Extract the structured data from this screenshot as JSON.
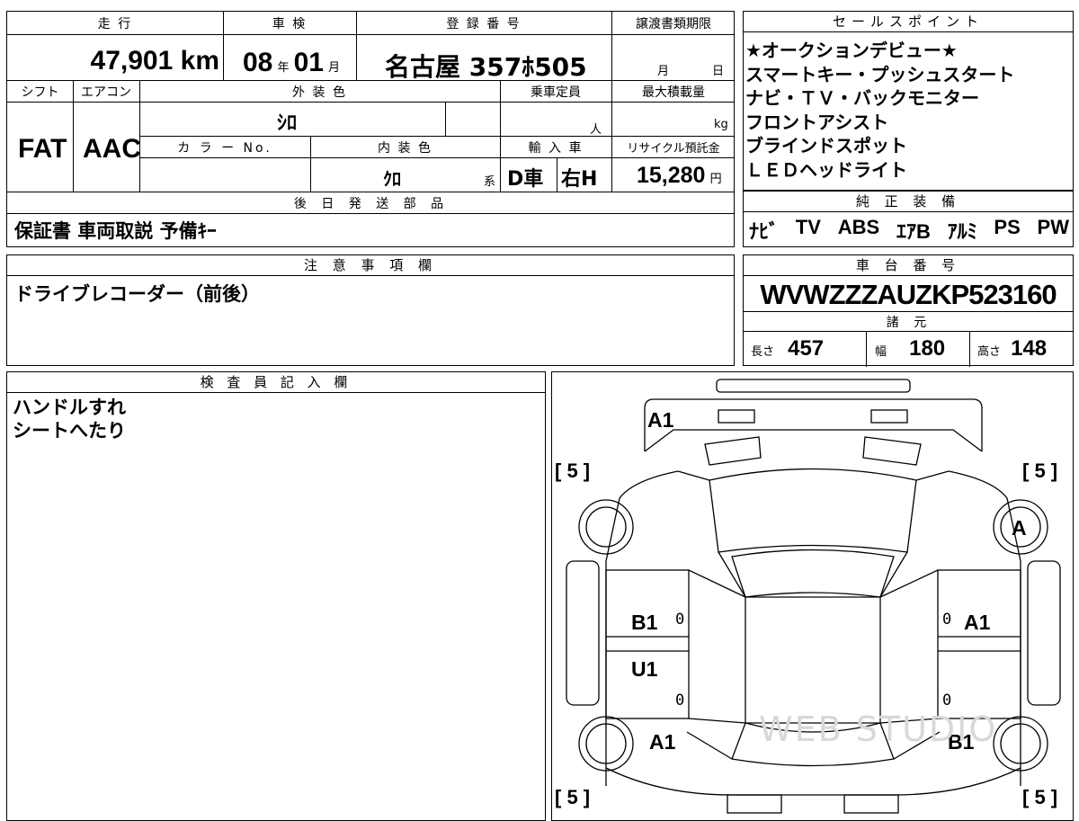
{
  "top_table": {
    "mileage_label": "走 行",
    "mileage_value": "47,901",
    "mileage_unit": "km",
    "inspection_label": "車 検",
    "inspection_year": "08",
    "inspection_year_unit": "年",
    "inspection_month": "01",
    "inspection_month_unit": "月",
    "plate_label": "登 録 番 号",
    "plate_value": "名古屋 357ﾎ505",
    "transfer_label": "譲渡書類期限",
    "transfer_month": "月",
    "transfer_day": "日",
    "shift_label": "シフト",
    "shift_value": "FAT",
    "ac_label": "エアコン",
    "ac_value": "AAC",
    "exterior_label": "外 装 色",
    "exterior_value": "ｼﾛ",
    "capacity_label": "乗車定員",
    "capacity_unit": "人",
    "max_load_label": "最大積載量",
    "max_load_unit": "kg",
    "color_no_label": "カ ラ ー No.",
    "interior_label": "内 装 色",
    "interior_value": "ｸﾛ",
    "interior_suffix": "系",
    "import_label": "輸 入 車",
    "import_value_1": "D車",
    "import_value_2": "右H",
    "recycle_label": "リサイクル預託金",
    "recycle_value": "15,280",
    "recycle_unit": "円",
    "later_parts_label": "後 日 発 送 部 品",
    "later_parts_value": "保証書 車両取説 予備ｷｰ"
  },
  "sales_points": {
    "label": "セールスポイント",
    "items": [
      "★オークションデビュー★",
      "スマートキー・プッシュスタート",
      "ナビ・ＴＶ・バックモニター",
      "フロントアシスト",
      "ブラインドスポット",
      "ＬＥＤヘッドライト"
    ]
  },
  "genuine_equipment": {
    "label": "純 正 装 備",
    "items": [
      "ﾅﾋﾞ",
      "TV",
      "ABS",
      "ｴｱB",
      "ｱﾙﾐ",
      "PS",
      "PW"
    ]
  },
  "notes": {
    "label": "注 意 事 項 欄",
    "value": "ドライブレコーダー（前後）"
  },
  "chassis": {
    "label": "車 台 番 号",
    "value": "WVWZZZAUZKP523160"
  },
  "specs": {
    "label": "諸 元",
    "length_label": "長さ",
    "length_value": "457",
    "width_label": "幅",
    "width_value": "180",
    "height_label": "高さ",
    "height_value": "148"
  },
  "inspector": {
    "label": "検 査 員 記 入 欄",
    "lines": [
      "ハンドルすれ",
      "シートへたり"
    ]
  },
  "diagram": {
    "marks": {
      "front_bumper": "A1",
      "front_left_fender": "B1",
      "front_right_fender": "A1",
      "rear_left_door": "U1",
      "rear_left_quarter": "A1",
      "rear_right_quarter": "B1",
      "front_right_wheel": "A"
    },
    "tire_tl": "[ 5 ]",
    "tire_tr": "[ 5 ]",
    "tire_bl": "[ 5 ]",
    "tire_br": "[ 5 ]",
    "zero": "0",
    "watermark": "WEB STUDIO"
  }
}
